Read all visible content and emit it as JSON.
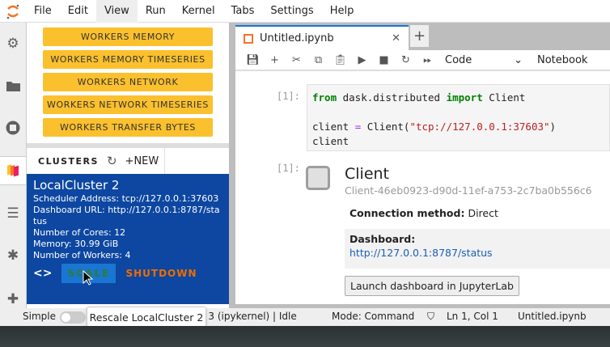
{
  "menu": [
    "File",
    "Edit",
    "View",
    "Run",
    "Kernel",
    "Tabs",
    "Settings",
    "Help"
  ],
  "dask_buttons": [
    "WORKERS MEMORY",
    "WORKERS MEMORY TIMESERIES",
    "WORKERS NETWORK",
    "WORKERS NETWORK TIMESERIES",
    "WORKERS TRANSFER BYTES"
  ],
  "clusters": {
    "title": "CLUSTERS",
    "new_label": "NEW",
    "cluster": {
      "name": "LocalCluster 2",
      "scheduler": "Scheduler Address: tcp://127.0.0.1:37603",
      "dashboard": "Dashboard URL: http://127.0.0.1:8787/status",
      "cores": "Number of Cores: 12",
      "memory": "Memory: 30.99 GiB",
      "workers": "Number of Workers: 4",
      "scale": "SCALE",
      "shutdown": "SHUTDOWN"
    }
  },
  "tab": {
    "title": "Untitled.ipynb"
  },
  "toolbar": {
    "cell_type": "Code",
    "right": "Notebook"
  },
  "cell1": {
    "prompt": "[1]:",
    "from": "from",
    "mod": " dask.distributed ",
    "import": "import",
    "cls": " Client",
    "l2a": "client ",
    "eq": "=",
    "l2b": " Client(",
    "str": "\"tcp://127.0.0.1:37603\"",
    "l2c": ")",
    "l3": "client"
  },
  "output": {
    "prompt": "[1]:",
    "title": "Client",
    "id": "Client-46eb0923-d90d-11ef-a753-2c7ba0b556c6",
    "conn_label": "Connection method:",
    "conn_value": " Direct",
    "dash_label": "Dashboard:",
    "dash_link": "http://127.0.0.1:8787/status",
    "launch": "Launch dashboard in JupyterLab"
  },
  "status": {
    "simple": "Simple",
    "kernel": "Python 3 (ipykernel) | Idle",
    "mode": "Mode: Command",
    "pos": "Ln 1, Col 1",
    "file": "Untitled.ipynb"
  },
  "tooltip": "Rescale LocalCluster 2",
  "colors": {
    "accent": "#1976d2",
    "cluster_bg": "#0d47a1",
    "dask_yellow": "#fbc02d",
    "shutdown": "#ef6c00"
  }
}
